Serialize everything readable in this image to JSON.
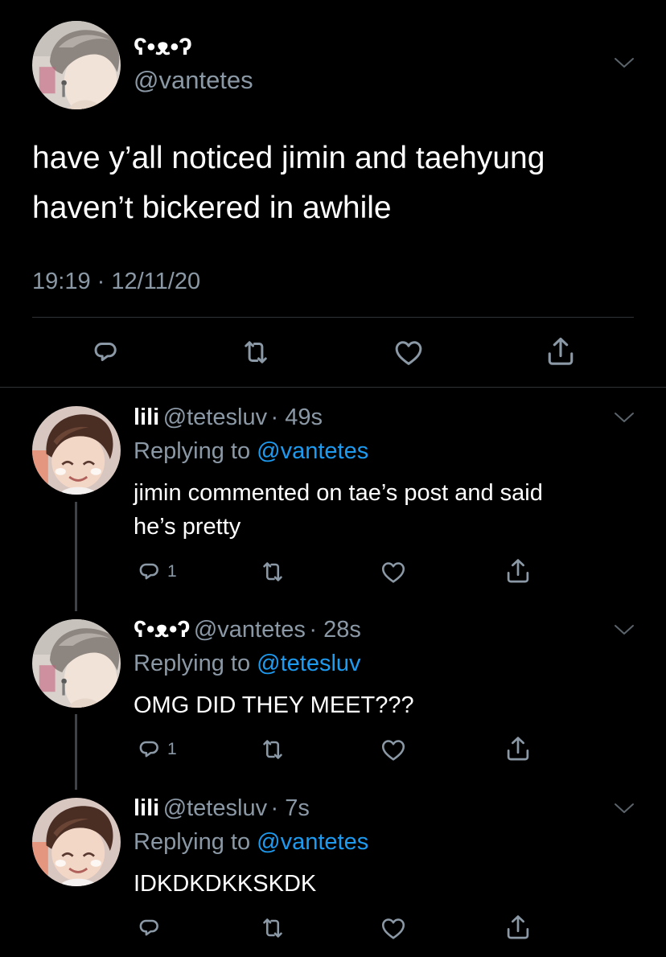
{
  "main_tweet": {
    "display_name": "ʕ•ᴥ•ʔ",
    "handle": "@vantetes",
    "text_line1": "have y’all noticed jimin and taehyung",
    "text_line2": "haven’t bickered in awhile",
    "timestamp": "19:19 · 12/11/20"
  },
  "replies": [
    {
      "display_name": "lili",
      "handle": "@tetesluv",
      "dot_time": "· 49s",
      "replying_prefix": "Replying to",
      "replying_to": "@vantetes",
      "text_line1": "jimin commented on tae’s post and said",
      "text_line2": "he’s pretty",
      "reply_count": "1"
    },
    {
      "display_name": "ʕ•ᴥ•ʔ",
      "handle": "@vantetes",
      "dot_time": "· 28s",
      "replying_prefix": "Replying to",
      "replying_to": "@tetesluv",
      "text_line1": "OMG DID THEY MEET???",
      "reply_count": "1"
    },
    {
      "display_name": "lili",
      "handle": "@tetesluv",
      "dot_time": "· 7s",
      "replying_prefix": "Replying to",
      "replying_to": "@vantetes",
      "text_line1": "IDKDKDKKSKDK",
      "reply_count": ""
    }
  ],
  "icons": [
    "reply-icon",
    "retweet-icon",
    "like-icon",
    "share-icon",
    "chevron-down-icon"
  ],
  "colors": {
    "background": "#000000",
    "text": "#ffffff",
    "muted": "#8b98a5",
    "link": "#1d9bf0",
    "divider": "#2f3336"
  }
}
